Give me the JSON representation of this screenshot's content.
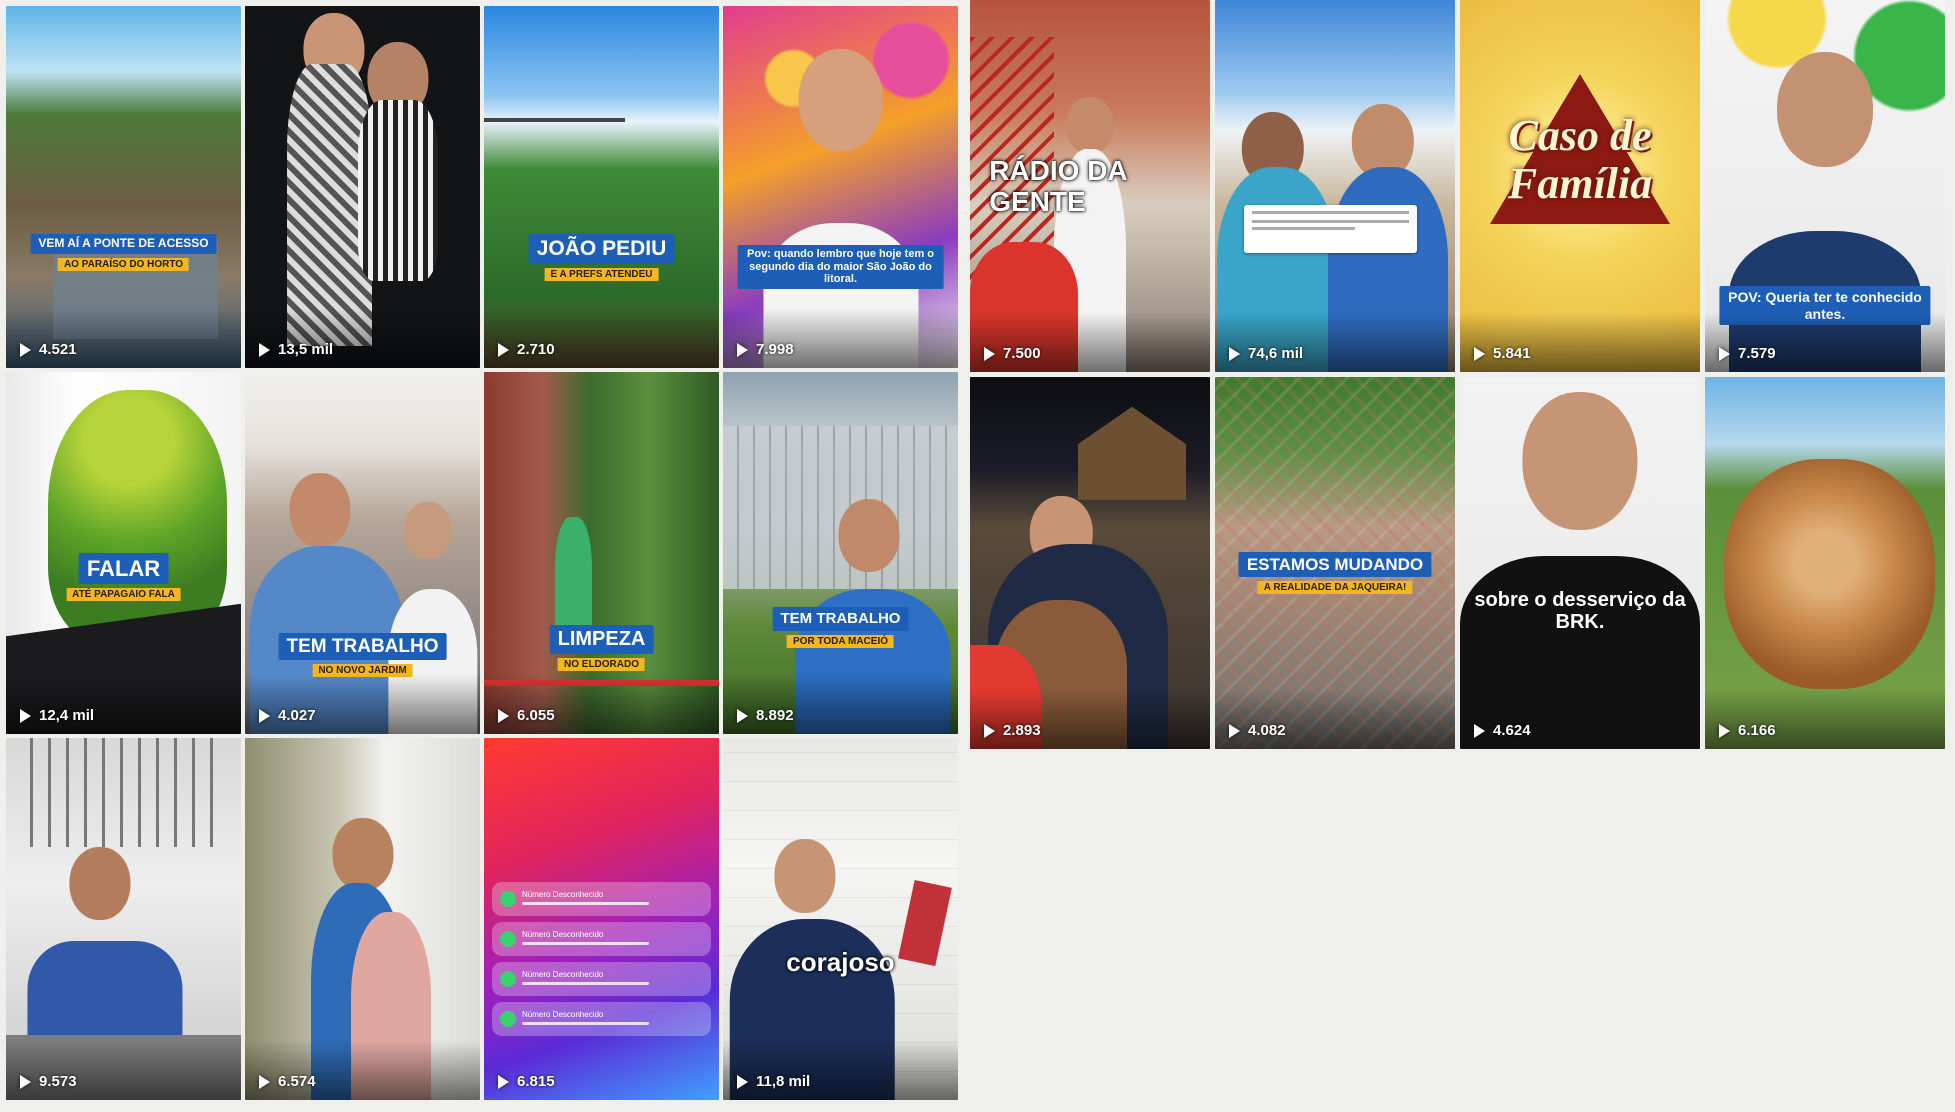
{
  "left_grid": [
    {
      "views": "4.521",
      "banner": "VEM AÍ A PONTE DE ACESSO",
      "sub": "AO PARAÍSO DO HORTO"
    },
    {
      "views": "13,5 mil"
    },
    {
      "views": "2.710",
      "banner": "JOÃO PEDIU",
      "sub": "E A PREFS ATENDEU"
    },
    {
      "views": "7.998",
      "banner": "Pov: quando lembro que hoje tem o segundo dia do maior São João do litoral."
    },
    {
      "views": "12,4 mil",
      "banner": "FALAR",
      "sub": "ATÉ PAPAGAIO FALA"
    },
    {
      "views": "4.027",
      "banner": "TEM TRABALHO",
      "sub": "NO NOVO JARDIM"
    },
    {
      "views": "6.055",
      "banner": "LIMPEZA",
      "sub": "NO ELDORADO"
    },
    {
      "views": "8.892",
      "banner": "TEM TRABALHO",
      "sub": "POR TODA MACEIÓ"
    },
    {
      "views": "9.573"
    },
    {
      "views": "6.574"
    },
    {
      "views": "6.815",
      "notifications": [
        "Número Desconhecido",
        "Número Desconhecido",
        "Número Desconhecido",
        "Número Desconhecido"
      ]
    },
    {
      "views": "11,8 mil",
      "caption": "corajoso"
    }
  ],
  "right_grid": [
    {
      "views": "7.500",
      "caption": "RÁDIO DA GENTE"
    },
    {
      "views": "74,6 mil"
    },
    {
      "views": "5.841",
      "caption": "Caso de Família"
    },
    {
      "views": "7.579",
      "banner": "POV: Queria ter te conhecido antes."
    },
    {
      "views": "2.893"
    },
    {
      "views": "4.082",
      "banner": "ESTAMOS MUDANDO",
      "sub": "A REALIDADE DA JAQUEIRA!"
    },
    {
      "views": "4.624",
      "caption": "sobre o desserviço da BRK."
    },
    {
      "views": "6.166"
    }
  ],
  "colors": {
    "background": "#efefec",
    "banner_blue": "#1d5fb6",
    "banner_yellow": "#f2b620"
  }
}
